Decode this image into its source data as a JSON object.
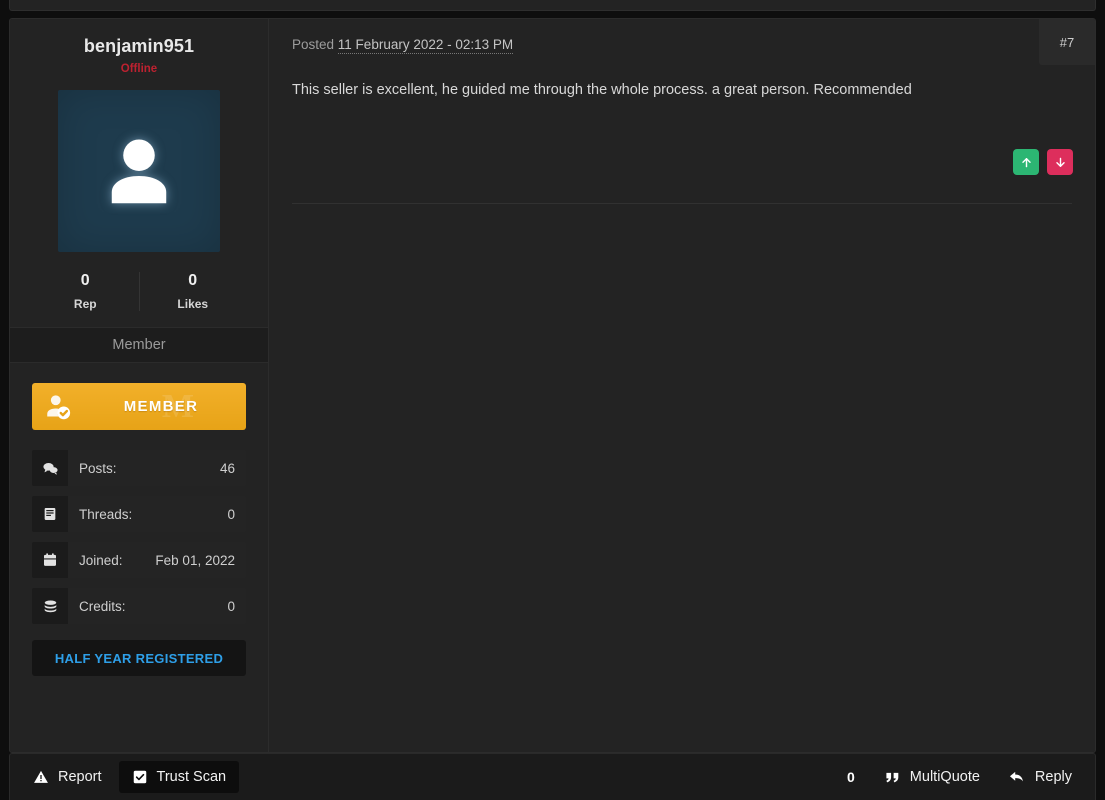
{
  "author": {
    "username": "benjamin951",
    "status": "Offline",
    "avatar_icon": "user-silhouette-icon",
    "stats": [
      {
        "value": "0",
        "label": "Rep"
      },
      {
        "value": "0",
        "label": "Likes"
      }
    ],
    "usergroup": "Member",
    "badge": {
      "text": "MEMBER",
      "watermark": "M",
      "icon": "user-verified-icon",
      "color": "#eda81d"
    },
    "info": [
      {
        "icon": "comments-icon",
        "label": "Posts:",
        "value": "46"
      },
      {
        "icon": "threads-icon",
        "label": "Threads:",
        "value": "0"
      },
      {
        "icon": "calendar-icon",
        "label": "Joined:",
        "value": "Feb 01, 2022"
      },
      {
        "icon": "coins-icon",
        "label": "Credits:",
        "value": "0"
      }
    ],
    "award": {
      "label": "HALF YEAR REGISTERED",
      "color": "#2e9fe8"
    }
  },
  "post": {
    "number": "#7",
    "posted_prefix": "Posted",
    "posted_date": "11 February 2022 - 02:13 PM",
    "body": "This seller is excellent, he guided me through the whole process. a great person. Recommended",
    "vote_up": {
      "icon": "arrow-up-icon",
      "color": "#2cb673"
    },
    "vote_down": {
      "icon": "arrow-down-icon",
      "color": "#dd2e5c"
    }
  },
  "toolbar": {
    "report_label": "Report",
    "report_icon": "warning-triangle-icon",
    "trust_scan_label": "Trust Scan",
    "trust_scan_icon": "checkbox-checked-icon",
    "quote_count": "0",
    "multiquote_label": "MultiQuote",
    "multiquote_icon": "quote-icon",
    "reply_label": "Reply",
    "reply_icon": "reply-arrow-icon"
  }
}
